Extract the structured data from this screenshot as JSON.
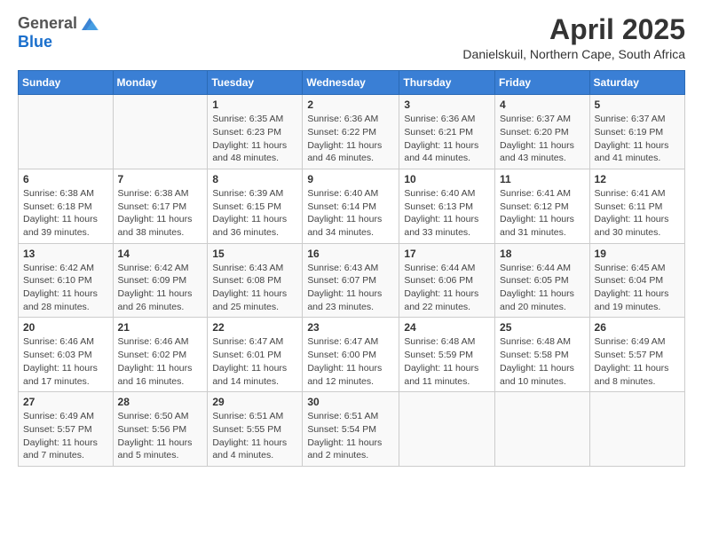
{
  "header": {
    "logo": {
      "line1": "General",
      "line2": "Blue"
    },
    "month_title": "April 2025",
    "subtitle": "Danielskuil, Northern Cape, South Africa"
  },
  "days_of_week": [
    "Sunday",
    "Monday",
    "Tuesday",
    "Wednesday",
    "Thursday",
    "Friday",
    "Saturday"
  ],
  "weeks": [
    [
      {
        "day": "",
        "detail": ""
      },
      {
        "day": "",
        "detail": ""
      },
      {
        "day": "1",
        "detail": "Sunrise: 6:35 AM\nSunset: 6:23 PM\nDaylight: 11 hours and 48 minutes."
      },
      {
        "day": "2",
        "detail": "Sunrise: 6:36 AM\nSunset: 6:22 PM\nDaylight: 11 hours and 46 minutes."
      },
      {
        "day": "3",
        "detail": "Sunrise: 6:36 AM\nSunset: 6:21 PM\nDaylight: 11 hours and 44 minutes."
      },
      {
        "day": "4",
        "detail": "Sunrise: 6:37 AM\nSunset: 6:20 PM\nDaylight: 11 hours and 43 minutes."
      },
      {
        "day": "5",
        "detail": "Sunrise: 6:37 AM\nSunset: 6:19 PM\nDaylight: 11 hours and 41 minutes."
      }
    ],
    [
      {
        "day": "6",
        "detail": "Sunrise: 6:38 AM\nSunset: 6:18 PM\nDaylight: 11 hours and 39 minutes."
      },
      {
        "day": "7",
        "detail": "Sunrise: 6:38 AM\nSunset: 6:17 PM\nDaylight: 11 hours and 38 minutes."
      },
      {
        "day": "8",
        "detail": "Sunrise: 6:39 AM\nSunset: 6:15 PM\nDaylight: 11 hours and 36 minutes."
      },
      {
        "day": "9",
        "detail": "Sunrise: 6:40 AM\nSunset: 6:14 PM\nDaylight: 11 hours and 34 minutes."
      },
      {
        "day": "10",
        "detail": "Sunrise: 6:40 AM\nSunset: 6:13 PM\nDaylight: 11 hours and 33 minutes."
      },
      {
        "day": "11",
        "detail": "Sunrise: 6:41 AM\nSunset: 6:12 PM\nDaylight: 11 hours and 31 minutes."
      },
      {
        "day": "12",
        "detail": "Sunrise: 6:41 AM\nSunset: 6:11 PM\nDaylight: 11 hours and 30 minutes."
      }
    ],
    [
      {
        "day": "13",
        "detail": "Sunrise: 6:42 AM\nSunset: 6:10 PM\nDaylight: 11 hours and 28 minutes."
      },
      {
        "day": "14",
        "detail": "Sunrise: 6:42 AM\nSunset: 6:09 PM\nDaylight: 11 hours and 26 minutes."
      },
      {
        "day": "15",
        "detail": "Sunrise: 6:43 AM\nSunset: 6:08 PM\nDaylight: 11 hours and 25 minutes."
      },
      {
        "day": "16",
        "detail": "Sunrise: 6:43 AM\nSunset: 6:07 PM\nDaylight: 11 hours and 23 minutes."
      },
      {
        "day": "17",
        "detail": "Sunrise: 6:44 AM\nSunset: 6:06 PM\nDaylight: 11 hours and 22 minutes."
      },
      {
        "day": "18",
        "detail": "Sunrise: 6:44 AM\nSunset: 6:05 PM\nDaylight: 11 hours and 20 minutes."
      },
      {
        "day": "19",
        "detail": "Sunrise: 6:45 AM\nSunset: 6:04 PM\nDaylight: 11 hours and 19 minutes."
      }
    ],
    [
      {
        "day": "20",
        "detail": "Sunrise: 6:46 AM\nSunset: 6:03 PM\nDaylight: 11 hours and 17 minutes."
      },
      {
        "day": "21",
        "detail": "Sunrise: 6:46 AM\nSunset: 6:02 PM\nDaylight: 11 hours and 16 minutes."
      },
      {
        "day": "22",
        "detail": "Sunrise: 6:47 AM\nSunset: 6:01 PM\nDaylight: 11 hours and 14 minutes."
      },
      {
        "day": "23",
        "detail": "Sunrise: 6:47 AM\nSunset: 6:00 PM\nDaylight: 11 hours and 12 minutes."
      },
      {
        "day": "24",
        "detail": "Sunrise: 6:48 AM\nSunset: 5:59 PM\nDaylight: 11 hours and 11 minutes."
      },
      {
        "day": "25",
        "detail": "Sunrise: 6:48 AM\nSunset: 5:58 PM\nDaylight: 11 hours and 10 minutes."
      },
      {
        "day": "26",
        "detail": "Sunrise: 6:49 AM\nSunset: 5:57 PM\nDaylight: 11 hours and 8 minutes."
      }
    ],
    [
      {
        "day": "27",
        "detail": "Sunrise: 6:49 AM\nSunset: 5:57 PM\nDaylight: 11 hours and 7 minutes."
      },
      {
        "day": "28",
        "detail": "Sunrise: 6:50 AM\nSunset: 5:56 PM\nDaylight: 11 hours and 5 minutes."
      },
      {
        "day": "29",
        "detail": "Sunrise: 6:51 AM\nSunset: 5:55 PM\nDaylight: 11 hours and 4 minutes."
      },
      {
        "day": "30",
        "detail": "Sunrise: 6:51 AM\nSunset: 5:54 PM\nDaylight: 11 hours and 2 minutes."
      },
      {
        "day": "",
        "detail": ""
      },
      {
        "day": "",
        "detail": ""
      },
      {
        "day": "",
        "detail": ""
      }
    ]
  ]
}
